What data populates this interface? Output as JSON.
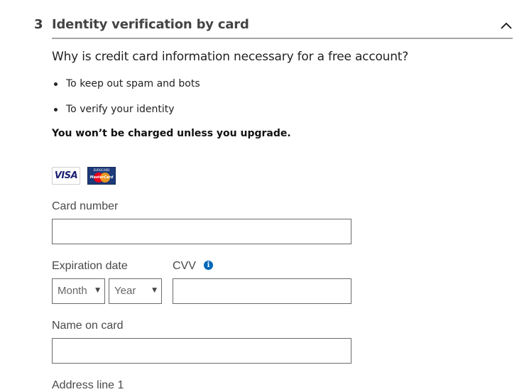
{
  "section": {
    "step_number": "3",
    "title": "Identity verification by card",
    "collapse_icon": "chevron-up-icon"
  },
  "intro": {
    "question": "Why is credit card information necessary for a free account?",
    "reasons": [
      "To keep out spam and bots",
      "To verify your identity"
    ],
    "notice": "You won’t be charged unless you upgrade."
  },
  "card_logos": {
    "visa": "VISA",
    "mastercard_caption": "EUROCARD",
    "mastercard_word": "MasterCard"
  },
  "form": {
    "card_number": {
      "label": "Card number",
      "value": ""
    },
    "expiration": {
      "label": "Expiration date",
      "month": {
        "selected": "Month"
      },
      "year": {
        "selected": "Year"
      }
    },
    "cvv": {
      "label": "CVV",
      "info_icon": "info-icon",
      "value": ""
    },
    "name_on_card": {
      "label": "Name on card",
      "value": ""
    },
    "address_line_1": {
      "label": "Address line 1"
    }
  },
  "colors": {
    "accent": "#0067b8",
    "header_rule": "#a6a6a6",
    "input_border": "#6b6b6b"
  }
}
